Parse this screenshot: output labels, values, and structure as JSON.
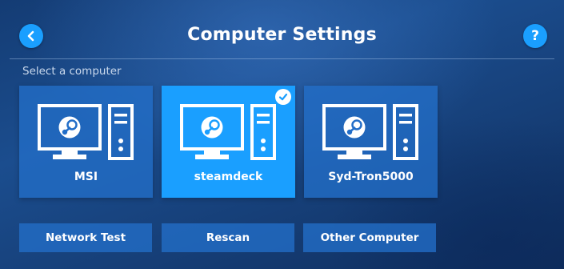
{
  "header": {
    "title": "Computer Settings",
    "back_icon": "chevron-left-icon",
    "help_icon": "question-mark-icon",
    "help_glyph": "?"
  },
  "section_label": "Select a computer",
  "computers": [
    {
      "name": "MSI",
      "icon": "steam-computer-icon",
      "selected": false
    },
    {
      "name": "steamdeck",
      "icon": "steam-computer-icon",
      "selected": true
    },
    {
      "name": "Syd-Tron5000",
      "icon": "steam-computer-icon",
      "selected": false
    }
  ],
  "actions": {
    "network_test": "Network Test",
    "rescan": "Rescan",
    "other_computer": "Other Computer"
  },
  "colors": {
    "accent": "#1a9fff",
    "card": "#236ec8",
    "background": "#1b4d8e"
  }
}
